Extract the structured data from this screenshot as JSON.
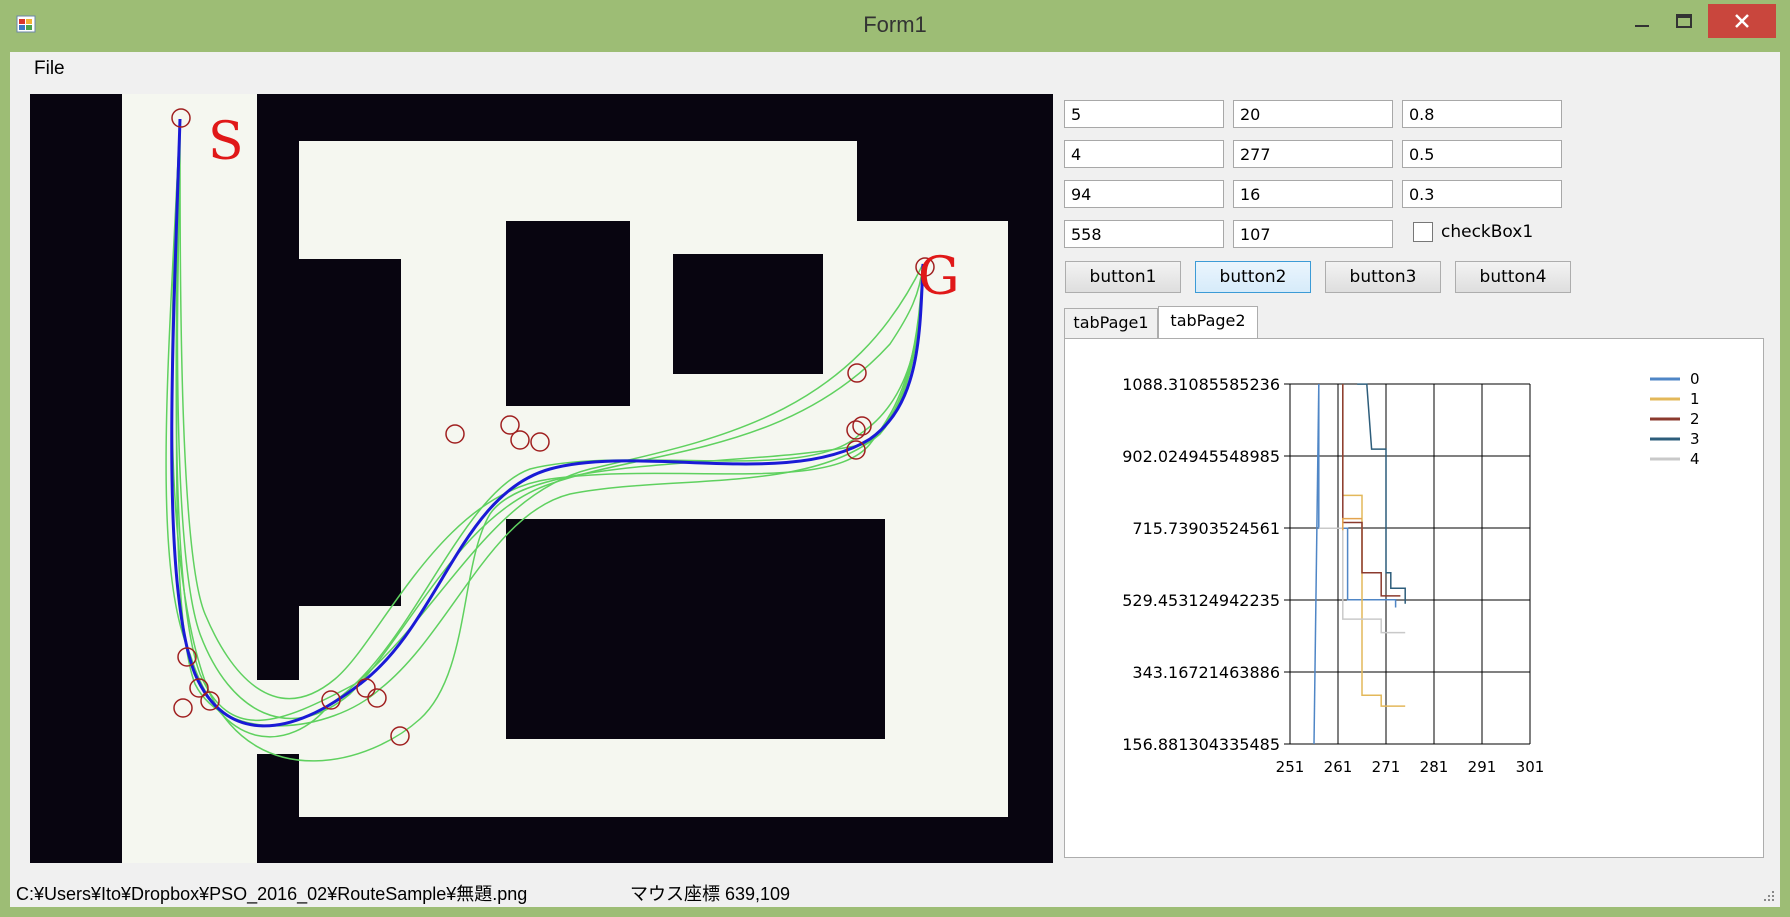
{
  "window": {
    "title": "Form1"
  },
  "menu": {
    "file": "File"
  },
  "map": {
    "start_label": "S",
    "goal_label": "G"
  },
  "fields": {
    "r1c1": "5",
    "r1c2": "20",
    "r1c3": "0.8",
    "r2c1": "4",
    "r2c2": "277",
    "r2c3": "0.5",
    "r3c1": "94",
    "r3c2": "16",
    "r3c3": "0.3",
    "r4c1": "558",
    "r4c2": "107"
  },
  "checkbox": {
    "label": "checkBox1",
    "checked": false
  },
  "buttons": {
    "b1": "button1",
    "b2": "button2",
    "b3": "button3",
    "b4": "button4"
  },
  "tabs": {
    "t1": "tabPage1",
    "t2": "tabPage2"
  },
  "status": {
    "path": "C:¥Users¥Ito¥Dropbox¥PSO_2016_02¥RouteSample¥無題.png",
    "mouse": "マウス座標   639,109"
  },
  "chart_data": {
    "type": "line",
    "xlim": [
      251,
      301
    ],
    "x_ticks": [
      "251",
      "261",
      "271",
      "281",
      "291",
      "301"
    ],
    "ylim": [
      156.881304335485,
      1088.31085585236
    ],
    "y_ticks": [
      "156.881304335485",
      "343.16721463886",
      "529.453124942235",
      "715.73903524561",
      "902.024945548985",
      "1088.31085585236"
    ],
    "grid": true,
    "legend_position": "top-right",
    "series": [
      {
        "name": "0",
        "color": "#4f86c6",
        "points": [
          [
            257,
            1088
          ],
          [
            257,
            715
          ],
          [
            263,
            715
          ],
          [
            263,
            530
          ],
          [
            268,
            530
          ],
          [
            268,
            530
          ],
          [
            273,
            530
          ],
          [
            273,
            510
          ]
        ]
      },
      {
        "name": "1",
        "color": "#e3b85a",
        "points": [
          [
            262,
            1088
          ],
          [
            262,
            800
          ],
          [
            266,
            800
          ],
          [
            266,
            283
          ],
          [
            270,
            283
          ],
          [
            270,
            255
          ],
          [
            275,
            255
          ]
        ]
      },
      {
        "name": "2",
        "color": "#8b3a2e",
        "points": [
          [
            262,
            1088
          ],
          [
            262,
            730
          ],
          [
            266,
            730
          ],
          [
            266,
            600
          ],
          [
            270,
            600
          ],
          [
            270,
            540
          ],
          [
            274,
            540
          ]
        ]
      },
      {
        "name": "3",
        "color": "#2d5d7b",
        "points": [
          [
            265,
            1088
          ],
          [
            267,
            1088
          ],
          [
            268,
            920
          ],
          [
            271,
            920
          ],
          [
            271,
            600
          ],
          [
            272,
            600
          ],
          [
            272,
            560
          ],
          [
            275,
            560
          ],
          [
            275,
            520
          ]
        ]
      },
      {
        "name": "4",
        "color": "#c9c9c9",
        "points": [
          [
            257,
            715
          ],
          [
            257,
            715
          ],
          [
            262,
            715
          ],
          [
            262,
            480
          ],
          [
            270,
            480
          ],
          [
            270,
            445
          ],
          [
            275,
            445
          ]
        ]
      },
      {
        "name": "",
        "color": "#4f86c6",
        "points": [
          [
            257,
            1088
          ],
          [
            256,
            156.9
          ]
        ]
      },
      {
        "name": "",
        "color": "#e3a34e",
        "points": [
          [
            262,
            710
          ],
          [
            262,
            740
          ],
          [
            266,
            740
          ]
        ]
      }
    ]
  }
}
